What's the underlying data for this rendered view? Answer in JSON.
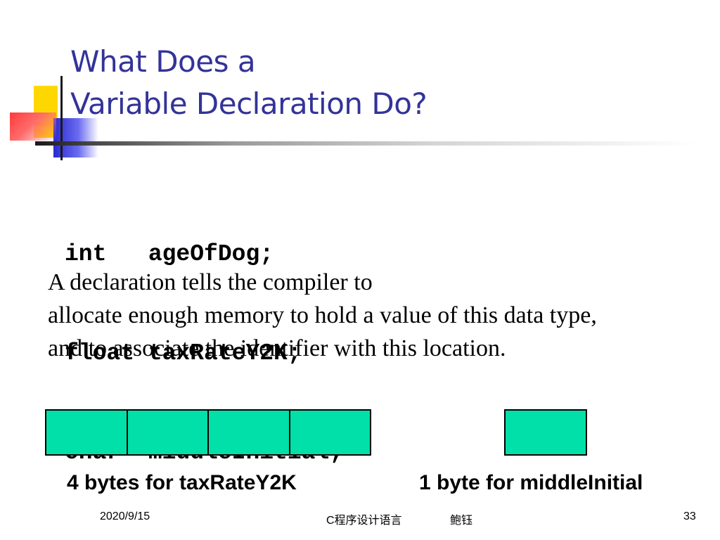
{
  "slide": {
    "title_lines": [
      "What Does a",
      "Variable Declaration Do?"
    ],
    "code_lines": [
      "int   ageOfDog;",
      "float taxRateY2K;",
      "char  middleInitial;"
    ],
    "description_lines": [
      "A declaration tells the compiler to",
      "allocate enough memory to hold a value of this data type,",
      "and to associate the identifier with this location."
    ],
    "memory": {
      "float_cells": 4,
      "char_cells": 1,
      "float_label": "4 bytes for taxRateY2K",
      "char_label": "1 byte for middleInitial",
      "cell_color": "#00e0a8"
    }
  },
  "footer": {
    "date": "2020/9/15",
    "course": "C程序设计语言",
    "author": "鲍钰",
    "page": "33"
  },
  "colors": {
    "title": "#333399",
    "accent_yellow": "#ffd700",
    "accent_blue": "#2a2ad0",
    "accent_red": "#ff3a3a"
  }
}
